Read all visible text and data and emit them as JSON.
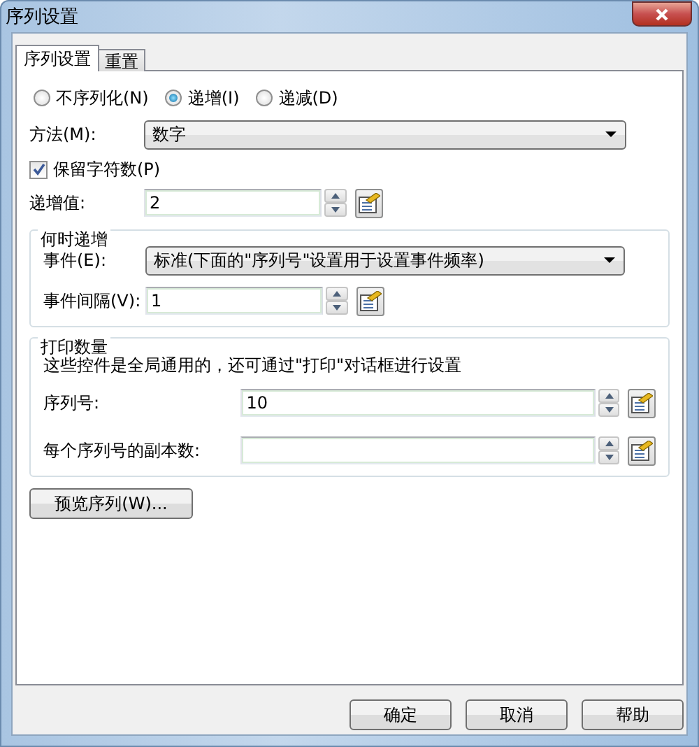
{
  "window": {
    "title": "序列设置"
  },
  "tabs": [
    {
      "label": "序列设置",
      "selected": true
    },
    {
      "label": "重置",
      "selected": false
    }
  ],
  "mode_options": [
    {
      "label": "不序列化(N)",
      "selected": false
    },
    {
      "label": "递增(I)",
      "selected": true
    },
    {
      "label": "递减(D)",
      "selected": false
    }
  ],
  "method": {
    "label": "方法(M):",
    "value": "数字"
  },
  "keep_digits": {
    "label": "保留字符数(P)",
    "checked": true
  },
  "increment": {
    "label": "递增值:",
    "value": "2"
  },
  "when_group": {
    "title": "何时递增",
    "event": {
      "label": "事件(E):",
      "value": "标准(下面的\"序列号\"设置用于设置事件频率)"
    },
    "interval": {
      "label": "事件间隔(V):",
      "value": "1"
    }
  },
  "print_group": {
    "title": "打印数量",
    "note": "这些控件是全局通用的，还可通过\"打印\"对话框进行设置",
    "serial": {
      "label": "序列号:",
      "value": "10"
    },
    "copies": {
      "label": "每个序列号的副本数:"
    }
  },
  "preview_button": "预览序列(W)...",
  "buttons": [
    "确定",
    "取消",
    "帮助"
  ]
}
